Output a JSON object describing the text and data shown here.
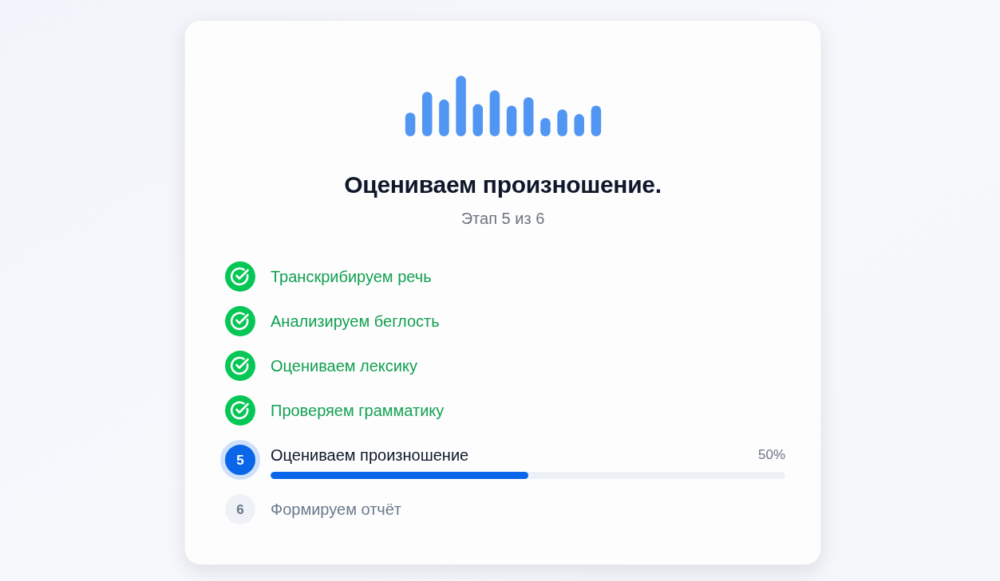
{
  "title": "Оцениваем произношение.",
  "subtitle": "Этап 5 из 6",
  "steps": [
    {
      "label": "Транскрибируем речь",
      "kind": "done"
    },
    {
      "label": "Анализируем беглость",
      "kind": "done"
    },
    {
      "label": "Оцениваем лексику",
      "kind": "done"
    },
    {
      "label": "Проверяем грамматику",
      "kind": "done"
    },
    {
      "label": "Оцениваем произношение",
      "kind": "active",
      "number": "5",
      "level": 0.5,
      "reading": "50%"
    },
    {
      "label": "Формируем отчёт",
      "kind": "pending",
      "number": "6"
    }
  ]
}
